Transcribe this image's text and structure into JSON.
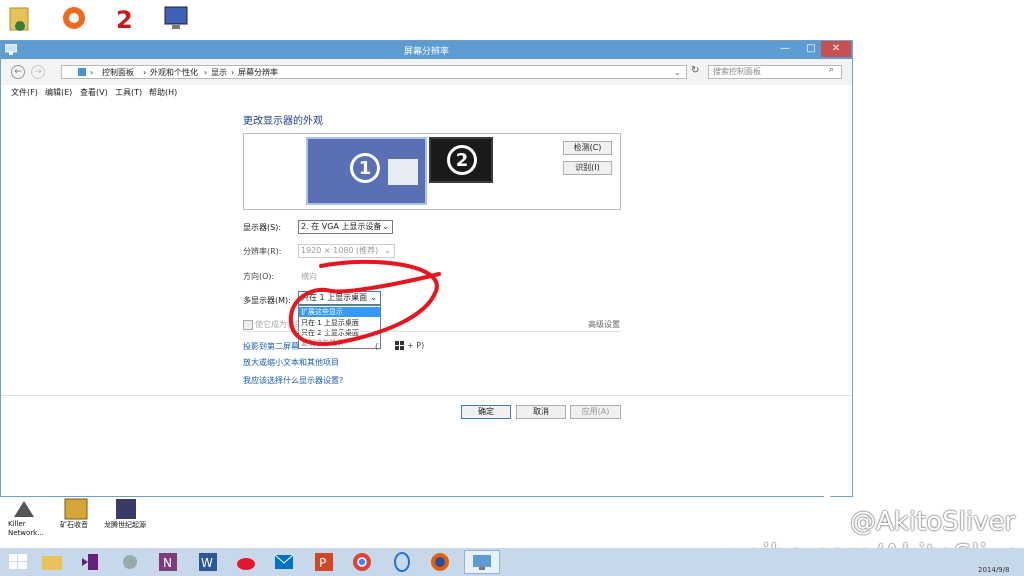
{
  "desktop": {
    "bottom_icons": [
      {
        "label": "Killer\nNetwork..."
      },
      {
        "label": "矿石收音"
      },
      {
        "label": "龙腾世纪起源"
      }
    ]
  },
  "window": {
    "title": "屏幕分辨率",
    "buttons": {
      "minimize": "—",
      "maximize": "□",
      "close": "✕"
    },
    "address": {
      "crumbs": [
        "控制面板",
        "外观和个性化",
        "显示",
        "屏幕分辨率"
      ],
      "search_placeholder": "搜索控制面板"
    },
    "menu": [
      "文件(F)",
      "编辑(E)",
      "查看(V)",
      "工具(T)",
      "帮助(H)"
    ]
  },
  "content": {
    "heading": "更改显示器的外观",
    "monitor1": "1",
    "monitor2": "2",
    "detect_button": "检测(C)",
    "identify_button": "识别(I)",
    "display_label": "显示器(S):",
    "display_value": "2. 在 VGA 上显示设备",
    "resolution_label": "分辨率(R):",
    "resolution_value": "1920 × 1080 (推荐)",
    "orientation_label": "方向(O):",
    "orientation_value": "横向",
    "multi_label": "多显示器(M):",
    "multi_value": "只在 1 上显示桌面",
    "multi_options": [
      "扩展这些显示",
      "只在 1 上显示桌面",
      "只在 2 上显示桌面",
      "复制这些显示"
    ],
    "main_display_checkbox": "使它成为我的主显示器",
    "advanced_link": "高级设置",
    "project_link": "投影到第二屏幕",
    "project_hint": "(或按 Windows 徽标键",
    "project_hint_end": "+ P)",
    "enlarge_link": "放大或缩小文本和其他项目",
    "which_link": "我应该选择什么显示器设置?",
    "ok_button": "确定",
    "cancel_button": "取消",
    "apply_button": "应用(A)"
  },
  "taskbar": {
    "clock_date": "2014/9/8"
  },
  "watermark": {
    "handle": "@AkitoSliver",
    "url": "weibo.com/AkitoSliver"
  },
  "colors": {
    "titlebar": "#5d9bd3",
    "close": "#c75050",
    "monitor1": "#5b6fb5",
    "monitor2": "#1a1a1a",
    "link": "#1a5bb4",
    "annotation_red": "#e8141e",
    "taskbar": "#c7d8ea"
  }
}
